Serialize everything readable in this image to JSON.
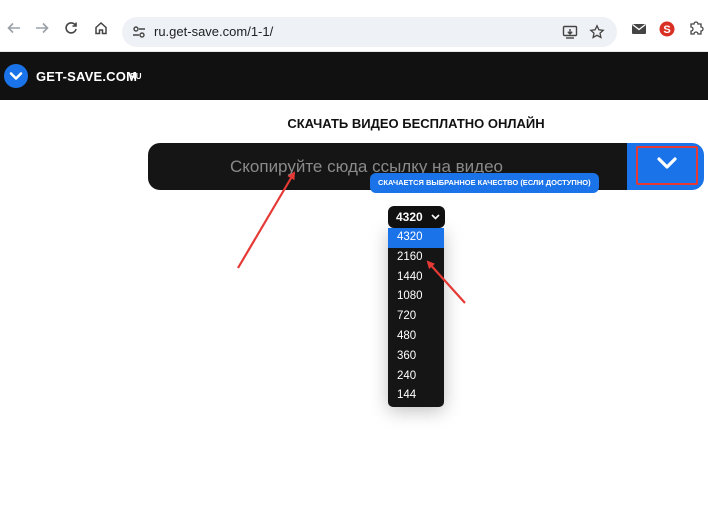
{
  "browser": {
    "url": "ru.get-save.com/1-1/",
    "icons": [
      "back-arrow-icon",
      "forward-arrow-icon",
      "reload-icon",
      "home-icon",
      "site-info-icon",
      "install-app-icon",
      "star-icon",
      "gmail-icon",
      "extension-s-icon",
      "puzzle-icon"
    ]
  },
  "header": {
    "logo_text": "GET-SAVE.COM",
    "logo_suffix": "RU"
  },
  "main": {
    "title": "СКАЧАТЬ ВИДЕО БЕСПЛАТНО ОНЛАЙН",
    "url_placeholder": "Скопируйте сюда ссылку на видео",
    "quality_tip": "СКАЧАЕТСЯ ВЫБРАННОЕ КАЧЕСТВО (ЕСЛИ ДОСТУПНО)",
    "quality_selected": "4320",
    "quality_options": [
      "4320",
      "2160",
      "1440",
      "1080",
      "720",
      "480",
      "360",
      "240",
      "144"
    ]
  },
  "colors": {
    "accent": "#1a73e8",
    "dark": "#111111",
    "annotation": "#e53935"
  }
}
